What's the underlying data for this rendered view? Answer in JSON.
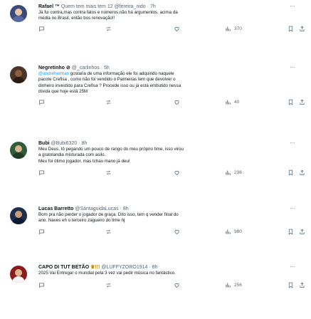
{
  "posts": [
    {
      "name": "Rafael",
      "badge": "™",
      "handle": "Quem tem mais tem 12 @fereira_nido",
      "time": "7h",
      "text_lines": [
        "Já fui contra,mas contra fatos e números,não há argumentos, acima da",
        "média no Brasil, então bos renovação!!"
      ],
      "replies": "",
      "retweets": "",
      "likes": "",
      "views": "370",
      "avatar_color": "#3a4a7a",
      "face_color": "#e8c7a8"
    },
    {
      "name": "Negretinho",
      "badge": "⊘",
      "handle": "@_carlinhos",
      "time": "5h",
      "text_lines": [
        "@andreherman gostaria de uma informação ele foi adquirido naquele",
        "pacote Crefisa , como não foi vendido o Palmeiras tem que devolver o",
        "dinheiro investido para Crefisa ? Procede isso ou já está embutido nessa",
        "dívida que hoje está 25M"
      ],
      "mention": "@andreherman",
      "replies": "",
      "retweets": "",
      "likes": "",
      "views": "40",
      "avatar_color": "#4b3428",
      "face_color": "#8b5e3c"
    },
    {
      "name": "Bubi",
      "badge": "",
      "handle": "@Bubi6320",
      "time": "8h",
      "text_lines": [
        "Meu Deus, tô pegando um pouco de rango do meu próprio time, isso virou",
        "a gratolandia misturada com asilo.",
        "Meu foi ótimo jogador, mas tchau mano já deu!"
      ],
      "replies": "",
      "retweets": "",
      "likes": "",
      "views": "236",
      "avatar_color": "#2f5d3a",
      "face_color": "#d9b38c"
    },
    {
      "name": "Lucas Barretto",
      "badge": "",
      "handle": "@SantaguidaLucas",
      "time": "8h",
      "text_lines": [
        "Bom pra não perder o jogador de graça. Dito isso, tem q vender final do",
        "ano. Naves eh o terceiro zagueiro do time hj"
      ],
      "replies": "",
      "retweets": "",
      "likes": "",
      "views": "980",
      "avatar_color": "#1f2e4d",
      "face_color": "#c89b7b"
    },
    {
      "name": "CAPO DI TUT BETÃO",
      "badge": "♛!!!",
      "handle": "@LUFFYZORO1914",
      "time": "8h",
      "text_lines": [
        "2025 Vai Entregar o mundial pela 3 vez vai pedir música no fantástico."
      ],
      "replies": "",
      "retweets": "",
      "likes": "",
      "views": "256",
      "avatar_color": "#8a1c1c",
      "face_color": "#e0b890"
    }
  ]
}
